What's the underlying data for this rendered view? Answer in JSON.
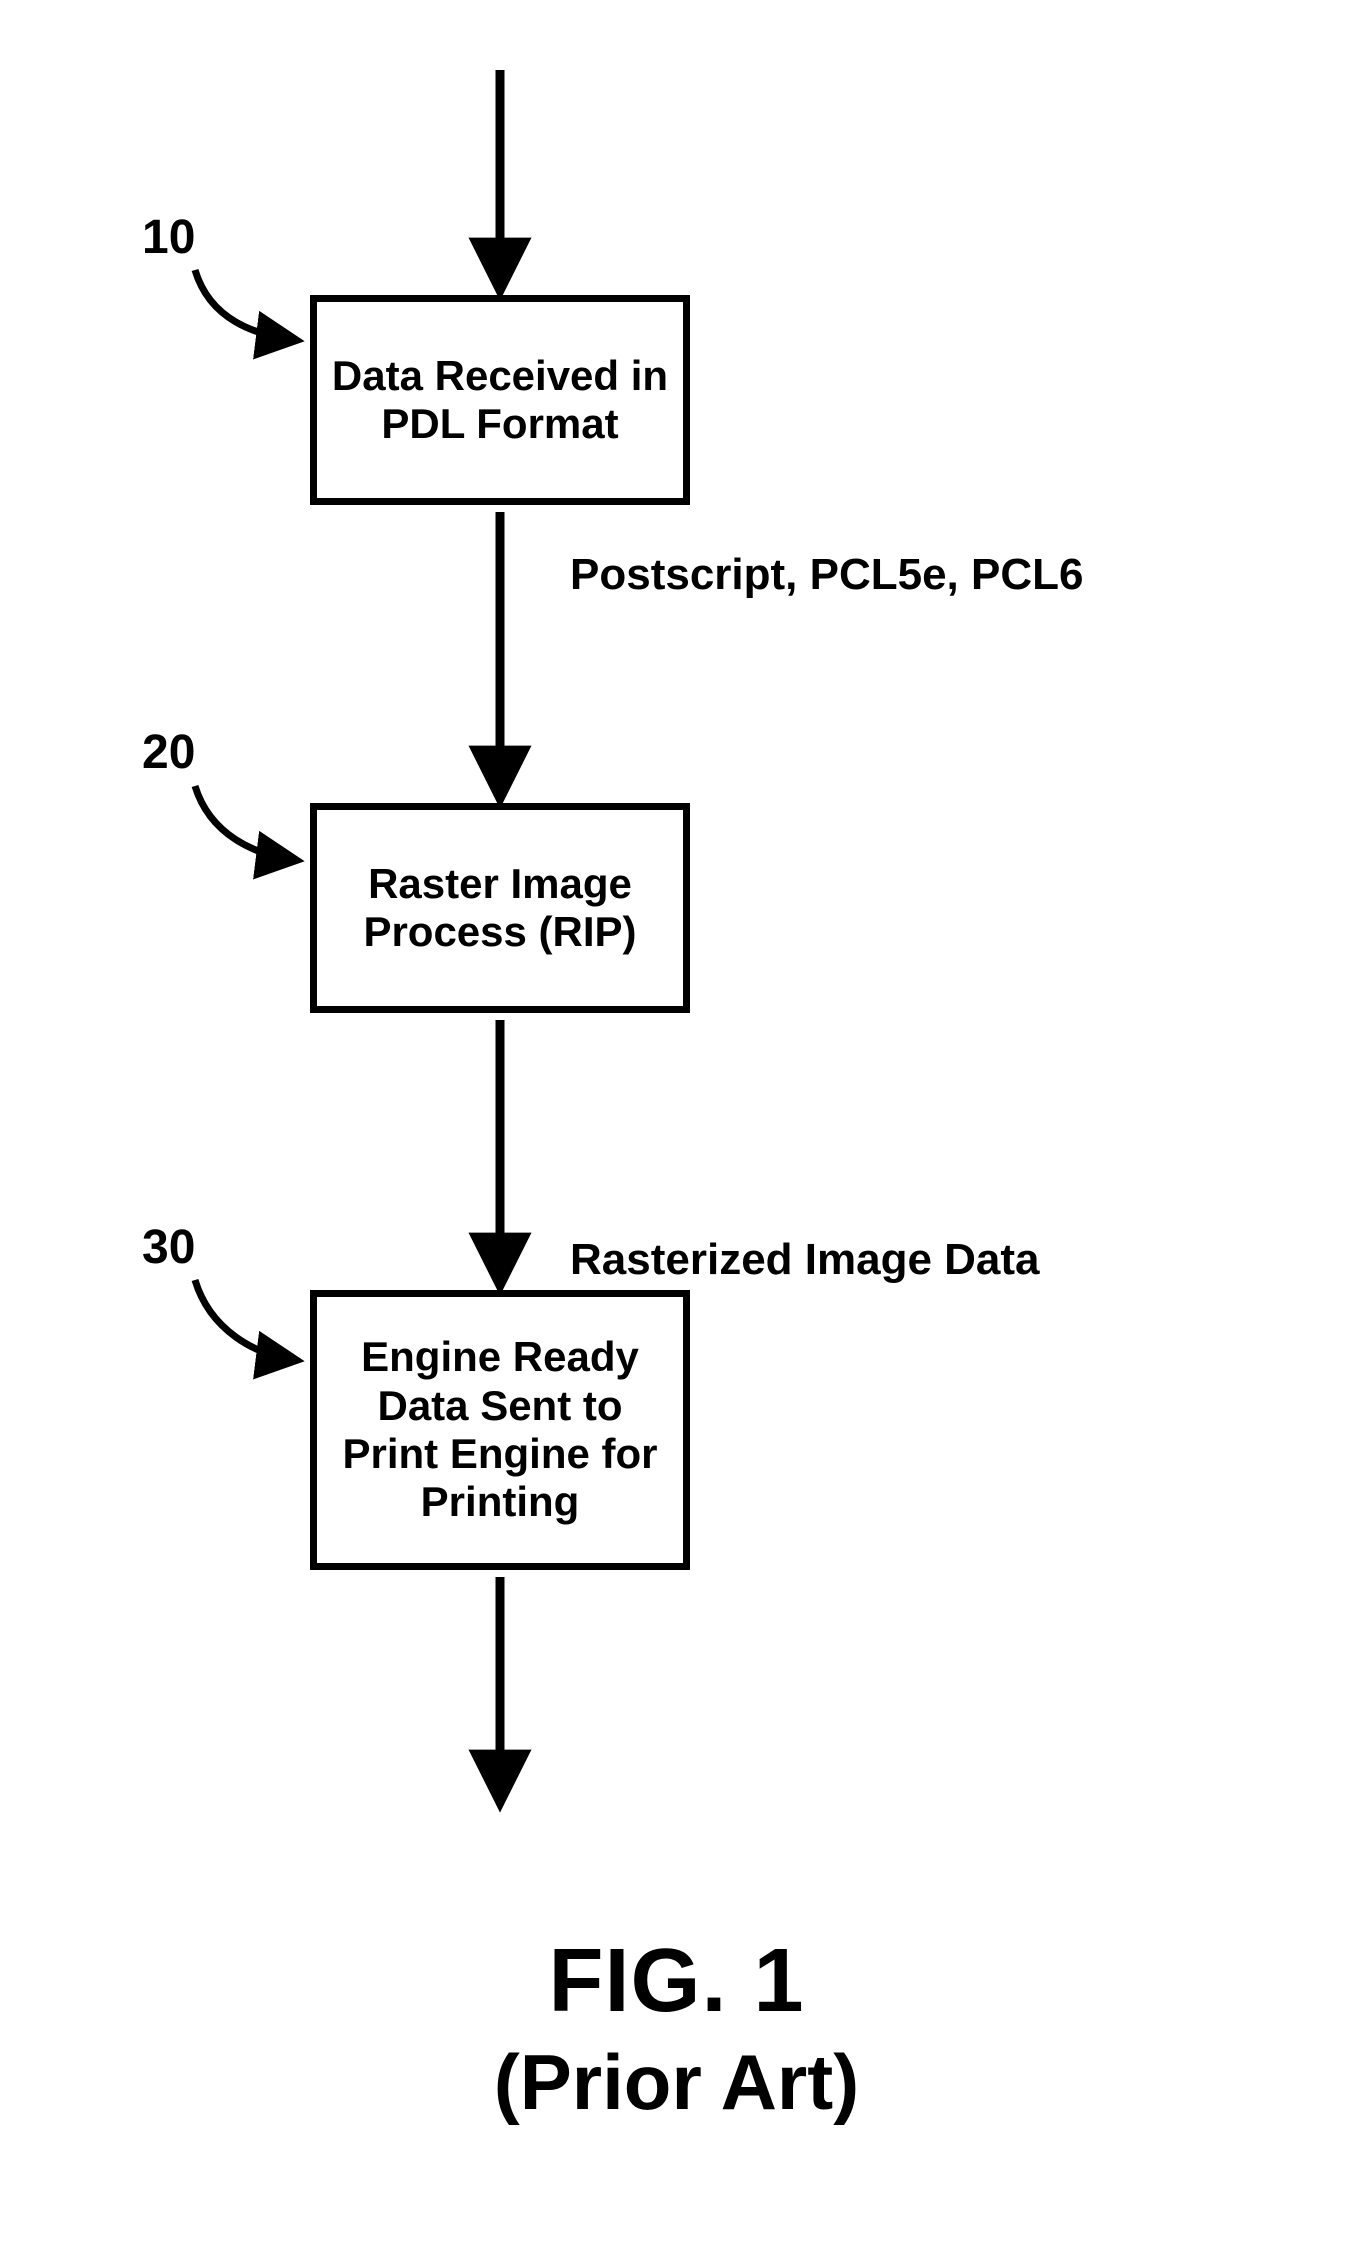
{
  "refs": {
    "r10": "10",
    "r20": "20",
    "r30": "30"
  },
  "boxes": {
    "b10": "Data Received in PDL Format",
    "b20": "Raster Image Process (RIP)",
    "b30": "Engine Ready Data Sent to Print Engine for Printing"
  },
  "annotations": {
    "a1": "Postscript, PCL5e, PCL6",
    "a2": "Rasterized Image Data"
  },
  "title": {
    "fig": "FIG. 1",
    "prior": "(Prior Art)"
  }
}
